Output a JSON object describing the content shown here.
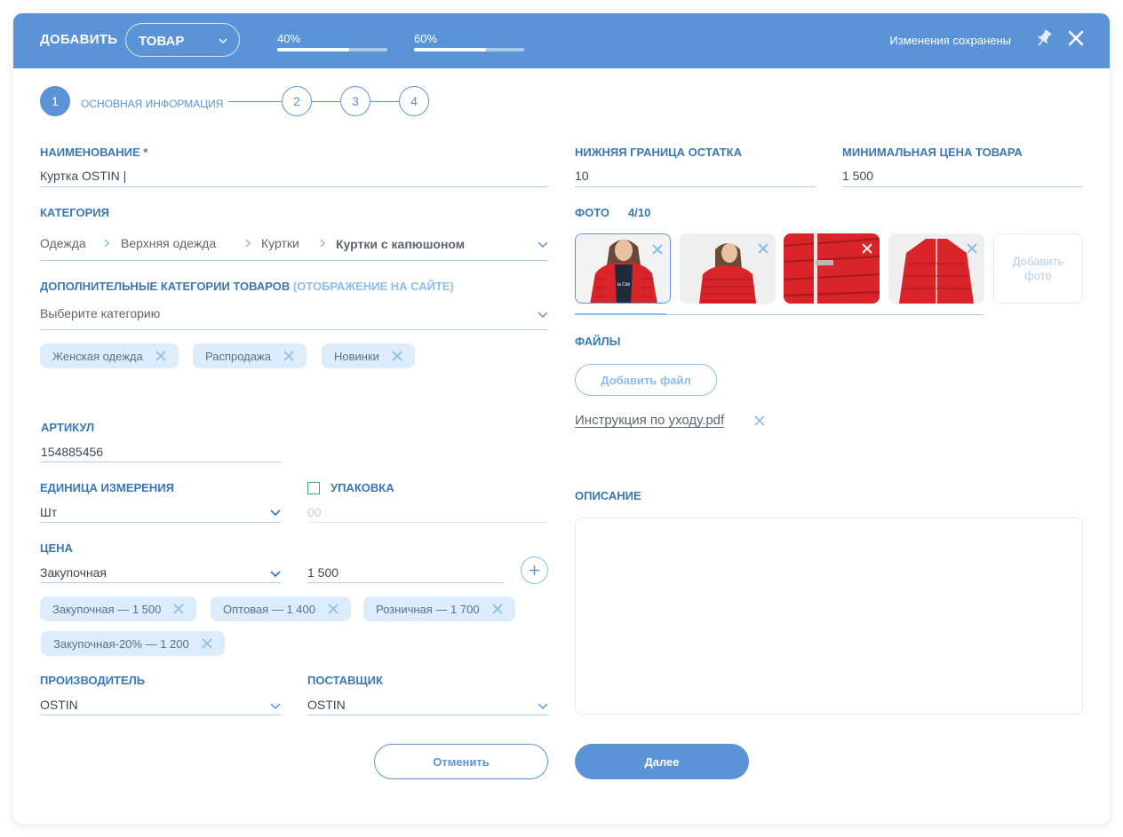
{
  "header": {
    "add_label": "ДОБАВИТЬ",
    "type_select": "ТОВАР",
    "progress": [
      {
        "label": "40%",
        "value": 0.65
      },
      {
        "label": "60%",
        "value": 0.65
      }
    ],
    "saved_status": "Изменения сохранены"
  },
  "steps": {
    "items": [
      {
        "number": "1",
        "title": "ОСНОВНАЯ ИНФОРМАЦИЯ",
        "active": true
      },
      {
        "number": "2"
      },
      {
        "number": "3"
      },
      {
        "number": "4"
      }
    ]
  },
  "form": {
    "name": {
      "label": "НАИМЕНОВАНИЕ *",
      "value": "Куртка OSTIN |"
    },
    "category": {
      "label": "КАТЕГОРИЯ",
      "path": [
        "Одежда",
        "Верхняя одежда",
        "Куртки",
        "Куртки с капюшоном"
      ]
    },
    "extra_categories": {
      "label": "ДОПОЛНИТЕЛЬНЫЕ КАТЕГОРИИ ТОВАРОВ",
      "label_hint": "(ОТОБРАЖЕНИЕ НА САЙТЕ)",
      "placeholder": "Выберите категорию",
      "chips": [
        "Женская одежда",
        "Распродажа",
        "Новинки"
      ]
    },
    "article": {
      "label": "АРТИКУЛ",
      "value": "154885456"
    },
    "unit": {
      "label": "ЕДИНИЦА ИЗМЕРЕНИЯ",
      "value": "Шт"
    },
    "package": {
      "label": "УПАКОВКА",
      "placeholder": "00"
    },
    "price": {
      "label": "ЦЕНА",
      "type": "Закупочная",
      "value": "1 500",
      "chips": [
        "Закупочная — 1 500",
        "Оптовая — 1 400",
        "Розничная — 1 700",
        "Закупочная-20% — 1 200"
      ]
    },
    "manufacturer": {
      "label": "ПРОИЗВОДИТЕЛЬ",
      "value": "OSTIN"
    },
    "supplier": {
      "label": "ПОСТАВЩИК",
      "value": "OSTIN"
    },
    "stock_min": {
      "label": "НИЖНЯЯ ГРАНИЦА ОСТАТКА",
      "value": "10"
    },
    "min_price": {
      "label": "МИНИМАЛЬНАЯ ЦЕНА ТОВАРА",
      "value": "1 500"
    },
    "photos": {
      "label": "ФОТО",
      "count": "4/10",
      "add_label": "Добавить фото"
    },
    "files": {
      "label": "ФАЙЛЫ",
      "add_button": "Добавить файл",
      "items": [
        "Инструкция по уходу.pdf"
      ]
    },
    "description": {
      "label": "ОПИСАНИЕ"
    }
  },
  "actions": {
    "cancel": "Отменить",
    "next": "Далее"
  },
  "colors": {
    "accent": "#5b94d6",
    "label": "#3a78b3",
    "chip_bg": "#ddecfa",
    "photo_red": "#d9242a"
  }
}
